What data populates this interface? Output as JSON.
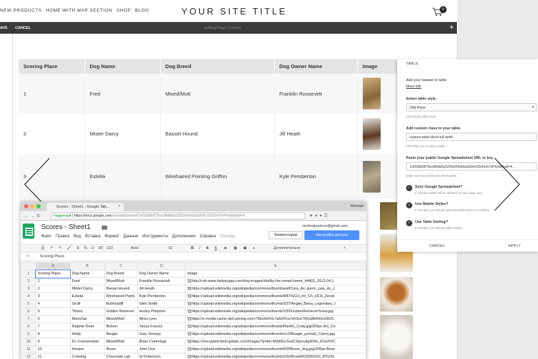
{
  "site": {
    "nav": [
      "NEW PRODUCTS",
      "HOME WITH MAP SECTION",
      "SHOP",
      "BLOG"
    ],
    "title": "YOUR SITE TITLE",
    "cart_count": "0"
  },
  "editbar": {
    "save": "AVE",
    "cancel": "CANCEL",
    "context": "Editing Page Content"
  },
  "site_table": {
    "headers": [
      "Scoring Place",
      "Dog Name",
      "Dog Breed",
      "Dog Owner Name",
      "Image"
    ],
    "rows": [
      [
        "1",
        "Fred",
        "Mixed/Mutt",
        "Franklin Roosevelt"
      ],
      [
        "2",
        "Mister Darcy",
        "Basset Hound",
        "Jill Heath"
      ],
      [
        "3",
        "Estelia",
        "Wirehaired Pointing Griffon",
        "Kyle Pemberton"
      ]
    ]
  },
  "panel": {
    "title": "TABLE",
    "dataset_label": "Add your dataset to table",
    "more_info": "More info",
    "style_label": "Select table style.",
    "style_value": "Odd Rows",
    "style_hint": "Select base table style.",
    "class_label": "Add custom class to your table.",
    "class_value": "custom-table-block-full-width",
    "class_hint": "This helps you to style a table.",
    "url_label": "Paste your public Google Spreadsheet URL or key.",
    "url_value": "1rKGNb58TIboUBdb5pS265zH0zEb/obGKUCk2toh7oPI/edit#gid=4...",
    "url_hint": "Make sure you made your sheet public.",
    "options": [
      {
        "label": "Sync Google Spreadsheet?",
        "hint": "If checked, table will be updated on each page load"
      },
      {
        "label": "Use Mobile Styles?",
        "hint": "If checked, you will get optimized table layout on mobiles"
      },
      {
        "label": "Use Table Sorting?",
        "hint": "If checked, you will get table sorting."
      }
    ],
    "cancel": "CANCEL",
    "apply": "APPLY"
  },
  "browser": {
    "tab_title": "Scores - Sheet1 - Google Tab...",
    "user": "Michael",
    "secure_label": "Надежный",
    "url_domain": "https://docs.google.com",
    "url_rest": "/spreadsheets/d/1rKGNb58TIboUBdb5pS265zH0zEb/obGKUCk2toh7oPI/edit#gid=4..."
  },
  "sheet": {
    "title": "Scores - Sheet1",
    "menu": [
      "Файл",
      "Правка",
      "Вид",
      "Вставка",
      "Формат",
      "Данные",
      "Инструменты",
      "Дополнения",
      "Справка",
      "Послед..."
    ],
    "email": "micheelparkour@gmail.com",
    "comments": "Комментарии",
    "share": "Настройки доступа",
    "font": "Arial",
    "font_size": "10",
    "zoom": "123",
    "more": "Дополнительно",
    "formula_value": "Scoring Place",
    "columns": [
      "A",
      "B",
      "C",
      "D",
      "E"
    ],
    "rows": [
      [
        "1",
        "Scoring Place",
        "Dog Name",
        "Dog Breed",
        "Dog Owner Name",
        "Image"
      ],
      [
        "2",
        "1",
        "Fred",
        "Mixed/Mutt",
        "Franklin Roosevelt",
        "![](http://cdn-www.dailypuppy.com/dog-images/shelby-the-mixed-breed_44402_2012-04-1"
      ],
      [
        "3",
        "2",
        "Mister Darcy",
        "Basset Hound",
        "Jill Heath",
        "![](https://upload.wikimedia.org/wikipedia/commons/thumb/a/af/Cara_de_quem_caiu_do_c"
      ],
      [
        "4",
        "3",
        "Estelia",
        "Wirehaired Pointi",
        "Kyle Pemberton",
        "![](https://upload.wikimedia.org/wikipedia/commons/thumb/8/87/GCH_Int_Ch_UCH_Zerub"
      ],
      [
        "5",
        "4",
        "Gruff",
        "Bullmastiff",
        "Glen Smith",
        "![](https://upload.wikimedia.org/wikipedia/commons/thumb/3/37/Anglel_Bless_Legendary_I"
      ],
      [
        "6",
        "5",
        "Timmy",
        "Golden Retriever",
        "Hurley Plimpton",
        "![](https://upload.wikimedia.org/wikipedia/commons/thumb/3/33/GoldenRetrieverSnow.jpg"
      ],
      [
        "7",
        "6",
        "Munchas",
        "Mixed/Mutt",
        "Missi Lynn",
        "![](https://s-media-cache-ak0.pinimg.com/736x/b0/41/7a/b041a7e53ce76b1bfb650e10b31"
      ],
      [
        "8",
        "7",
        "Ralphie Dean",
        "Bichon",
        "Tanya Francis",
        "![](https://upload.wikimedia.org/wikipedia/commons/thumb/f/fa/AG_Cody.jpg/250px-AG_Co"
      ],
      [
        "9",
        "8",
        "Wally",
        "Beagle",
        "Gary Snoopy",
        "![](https://upload.wikimedia.org/wikipedia/commons/thumb/c/c2/Beagle_portrait_Camry.jpg"
      ],
      [
        "10",
        "9",
        "Dr. Frankenstein",
        "Mixed/Mutt",
        "Brian Cummings",
        "![](https://encrypted-tbn0.gstatic.com/images?q=tbn:ANd9GcSs3C3qovukgW0tv_lClorFDC"
      ],
      [
        "11",
        "10",
        "Hooper",
        "Boxer",
        "John Doe",
        "![](https://upload.wikimedia.org/wikipedia/commons/thumb/6/6f/Boxer_dog.jpg/200px-Boxe"
      ],
      [
        "12",
        "11",
        "Corndog",
        "Chocolate Lab",
        "Si Robertson",
        "![](https://upload.wikimedia.org/wikipedia/commons/thumb/2/2b/BoraDK20050331.JPG/20"
      ]
    ]
  },
  "colors": {
    "editbar": "#3b3b3b",
    "sheets_green": "#1fa463",
    "share_blue": "#4d90fe"
  }
}
